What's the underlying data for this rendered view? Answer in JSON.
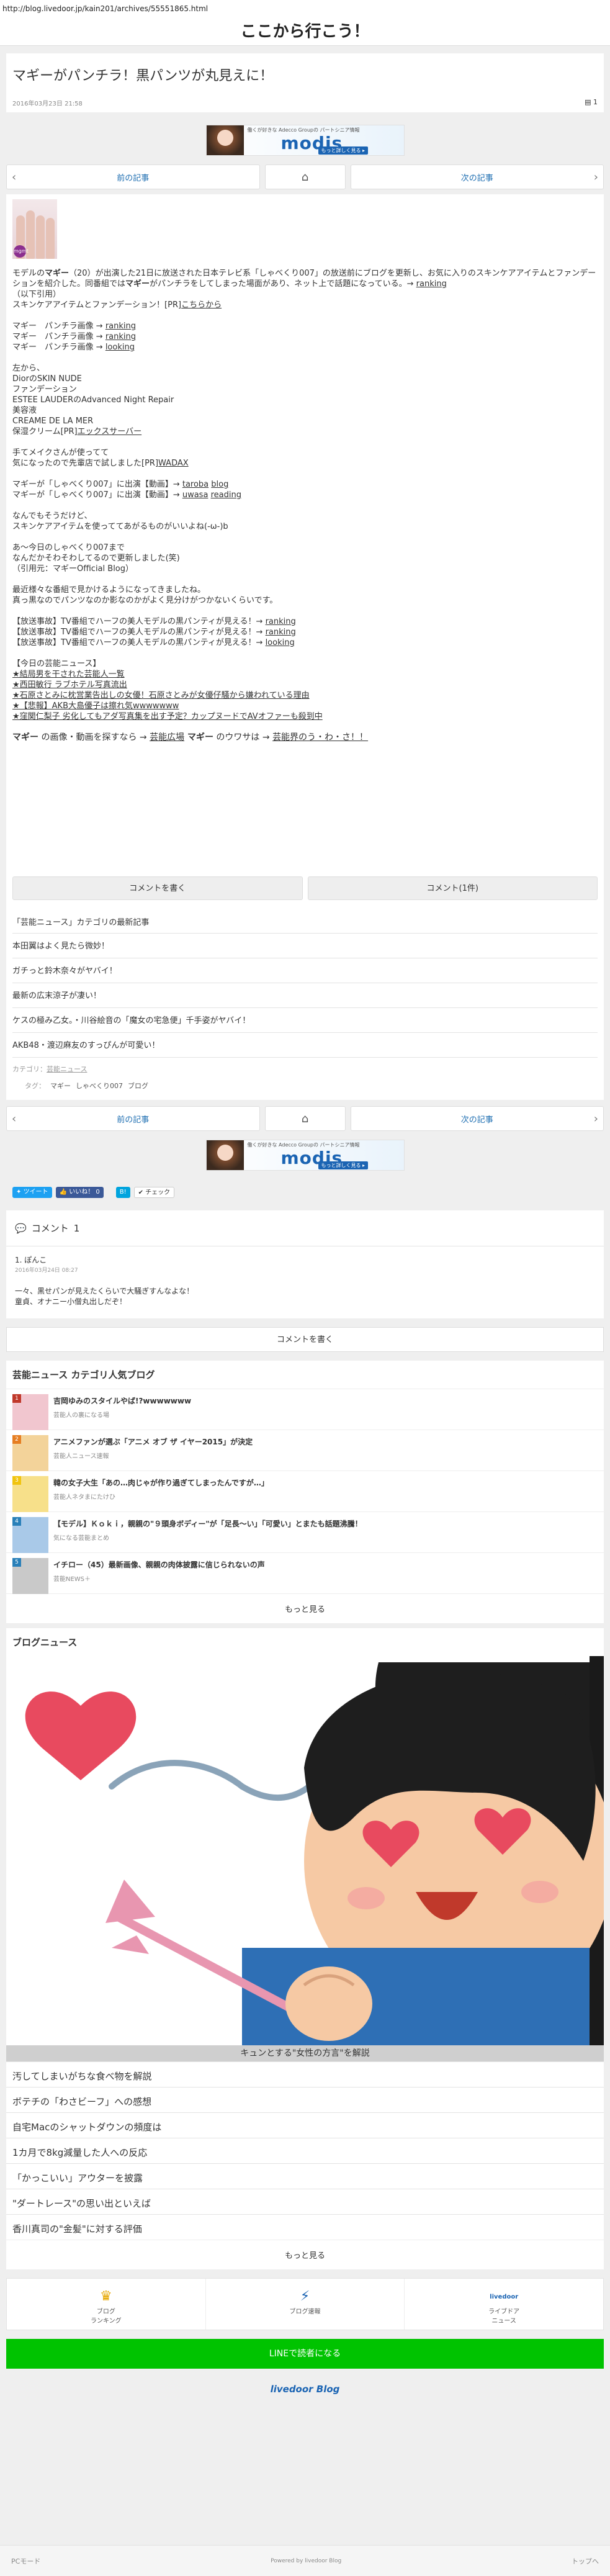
{
  "browser": {
    "url": "http://blog.livedoor.jp/kain201/archives/55551865.html"
  },
  "site": {
    "title": "ここから行こう！"
  },
  "post": {
    "title": "マギーがパンチラ！黒パンツが丸見えに！",
    "date": "2016年03月23日 21:58",
    "comment_count": "1"
  },
  "ad": {
    "tagline": "働くが好きな Adecco Groupの パートシニア情報",
    "logo": "modis",
    "cta": "もっと詳しく見る ▸"
  },
  "nav": {
    "prev": "前の記事",
    "next": "次の記事"
  },
  "article": {
    "thumb_badge": "mgmt",
    "p1_a": "モデルの",
    "p1_bold": "マギー",
    "p1_b": "（20）が出演した21日に放送された日本テレビ系「しゃべくり007」の放送前にブログを更新し、お気に入りのスキンケアアイテムとファンデーションを紹介した。同番組では",
    "p1_bold2": "マギー",
    "p1_c": "がパンチラをしてしまった場面があり、ネット上で話題になっている。→ ",
    "p1_link": "ranking",
    "p2": "（以下引用）",
    "p3": "スキンケアアイテムとファンデーション！[PR]",
    "p3_link": "こちらから",
    "img_lines": [
      {
        "label": "マギー　パンチラ画像 → ",
        "link": "ranking"
      },
      {
        "label": "マギー　パンチラ画像 → ",
        "link": "ranking"
      },
      {
        "label": "マギー　パンチラ画像 → ",
        "link": "looking"
      }
    ],
    "products": [
      "左から、",
      "DiorのSKIN NUDE",
      "ファンデーション",
      "ESTEE LAUDERのAdvanced Night Repair",
      "美容液",
      "CREAME DE LA MER",
      "保湿クリーム[PR]"
    ],
    "products_link": "エックスサーバー",
    "p4_1": "手てメイクさんが使ってて",
    "p4_2": "気になったので先輩店で試しました[PR]",
    "p4_link": "WADAX",
    "show_lines": [
      {
        "label": "マギーが「しゃべくり007」に出演【動画】→ ",
        "links": [
          "taroba",
          "blog"
        ]
      },
      {
        "label": "マギーが「しゃべくり007」に出演【動画】→ ",
        "links": [
          "uwasa",
          "reading"
        ]
      }
    ],
    "p5_1": "なんでもそうだけど、",
    "p5_2": "スキンケアアイテムを使っててあがるものがいいよね(-ω-)b",
    "p6_1": "あ〜今日のしゃべくり007まで",
    "p6_2": "なんだかそわそわしてるので更新しました(笑)",
    "p6_3": "（引用元：マギーOfficial Blog）",
    "p7_1": "最近様々な番組で見かけるようになってきましたね。",
    "p7_2": "真っ黒なのでパンツなのか影なのかがよく見分けがつかないくらいです。",
    "broadcast": [
      {
        "label": "【放送事故】TV番組でハーフの美人モデルの黒パンティが見える！→ ",
        "link": "ranking"
      },
      {
        "label": "【放送事故】TV番組でハーフの美人モデルの黒パンティが見える！→ ",
        "link": "ranking"
      },
      {
        "label": "【放送事故】TV番組でハーフの美人モデルの黒パンティが見える！→ ",
        "link": "looking"
      }
    ],
    "today_head": "【今日の芸能ニュース】",
    "today": [
      "★結局男を干された芸能人一覧",
      "★西田敏行 ラブホテル写真流出",
      "★石原さとみに枕営業告出しの女優！石原さとみが女優仔騒から嫌われている理由",
      "★【悲報】AKB大島優子は擦れ気wwwwwww",
      "★窪関仁梨子 劣化してもアダ写真集を出す予定？カップヌードでAVオファーも殺到中"
    ],
    "footer_a": "マギー",
    "footer_b": " の画像・動画を探すなら → ",
    "footer_link1": "芸能広場",
    "footer_c": " マギー",
    "footer_d": " のウワサは → ",
    "footer_link2": "芸能界のう・わ・さ！！"
  },
  "comment_buttons": {
    "write": "コメントを書く",
    "view": "コメント(1件)"
  },
  "category": {
    "title": "「芸能ニュース」カテゴリの最新記事",
    "items": [
      "本田翼はよく見たら微妙！",
      "ガチっと鈴木奈々がヤバイ！",
      "最新の広末涼子が凄い！",
      "ケスの極み乙女。・川谷絵音の「魔女の宅急便」千手姿がヤバイ！",
      "AKB48・渡辺麻友のすっぴんが可愛い！"
    ],
    "label_cat": "カテゴリ：",
    "cat_value": "芸能ニュース",
    "label_tag": "タグ：",
    "tags": [
      "マギー",
      "しゃべくり007",
      "ブログ"
    ]
  },
  "share": {
    "tweet": "ツイート",
    "like": "いいね！ 0",
    "hatena": "B!",
    "check": "チェック"
  },
  "comments": {
    "head": "コメント",
    "count": "1",
    "author": "1. ぽんこ",
    "date": "2016年03月24日 08:27",
    "line1": "一々、黒せパンが見えたくらいで大騒ぎすんなよな！",
    "line2": "童貞、オナニー小僧丸出しだぞ！",
    "write": "コメントを書く"
  },
  "popular": {
    "head": "芸能ニュース カテゴリ人気ブログ",
    "items": [
      {
        "rank": "1",
        "title": "吉岡ゆみのスタイルやば!?wwwwwww",
        "sub": "芸能人の裏になる場",
        "color": "#c0392b"
      },
      {
        "rank": "2",
        "title": "アニメファンが選ぶ「アニメ オブ ザ イヤー2015」が決定",
        "sub": "芸能人ニュース速報",
        "color": "#e67e22"
      },
      {
        "rank": "3",
        "title": "韓の女子大生「あの…肉じゃが作り過ぎてしまったんですが…」",
        "sub": "芸能人ネタまにたけひ",
        "color": "#f1c40f"
      },
      {
        "rank": "4",
        "title": "【モデル】Ｋｏｋｉ，親親の\"９頭身ボディー\"が「足長〜い」「可愛い」とまたも話題沸騰！",
        "sub": "気になる芸能まとめ",
        "color": "#2980b9"
      },
      {
        "rank": "5",
        "title": "イチロー（45）最新画像、親親の肉体披露に信じられないの声",
        "sub": "芸能NEWS＋",
        "color": "#2980b9"
      }
    ],
    "more": "もっと見る"
  },
  "blognews": {
    "head": "ブログニュース",
    "caption": "キュンとする\"女性の方言\"を解説",
    "items": [
      "汚してしまいがちな食べ物を解説",
      "ボテチの「わさビーフ」への感想",
      "自宅Macのシャットダウンの頻度は",
      "1カ月で8kg減量した人への反応",
      "「かっこいい」アウターを披露",
      "\"ダートレース\"の思い出といえば",
      "香川真司の\"金髪\"に対する評価"
    ],
    "more": "もっと見る"
  },
  "footer": {
    "rank": "ブログ\nランキング",
    "news": "ブログ速報",
    "live": "ライブドア\nニュース",
    "live_logo": "livedoor",
    "line": "LINEで読者になる",
    "logo": "livedoor Blog",
    "pc": "PCモード",
    "powered": "Powered by livedoor Blog",
    "top": "トップへ"
  }
}
